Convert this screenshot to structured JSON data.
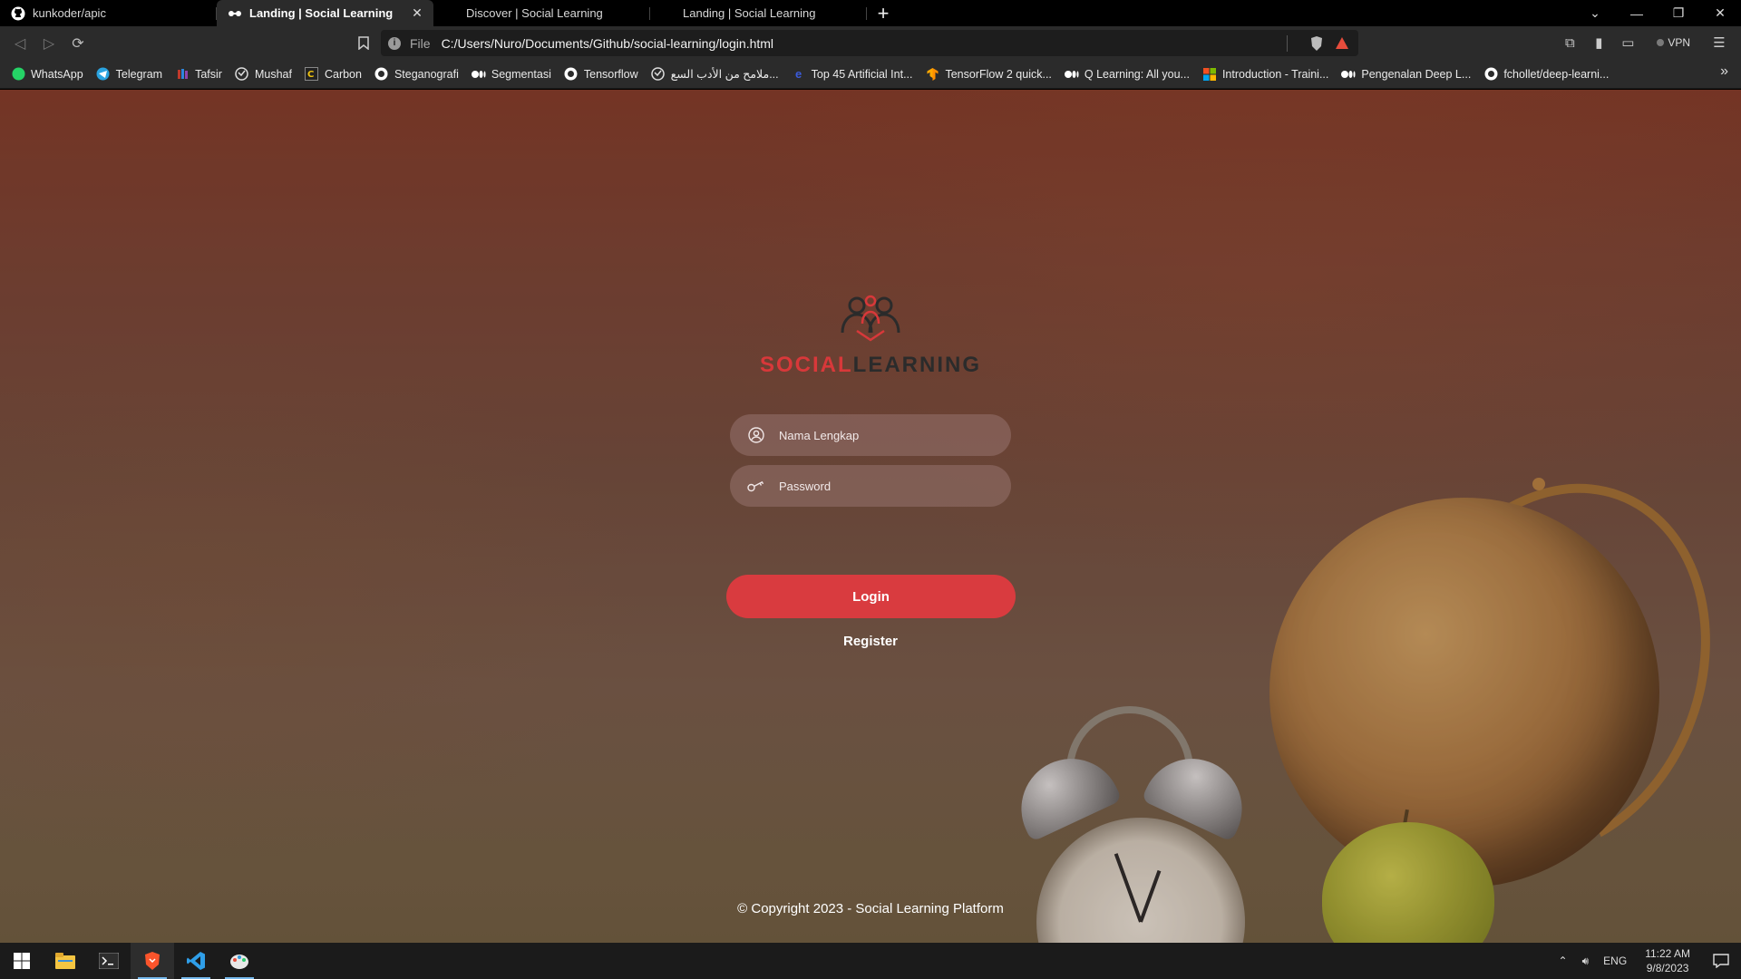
{
  "browser": {
    "tabs": [
      {
        "title": "kunkoder/apic",
        "icon": "github-icon",
        "active": false
      },
      {
        "title": "Landing | Social Learning",
        "icon": "social-learning-icon",
        "active": true
      },
      {
        "title": "Discover | Social Learning",
        "icon": "",
        "active": false
      },
      {
        "title": "Landing | Social Learning",
        "icon": "",
        "active": false
      }
    ],
    "new_tab_label": "+",
    "address": {
      "scheme_label": "File",
      "url": "C:/Users/Nuro/Documents/Github/social-learning/login.html"
    },
    "vpn_label": "VPN",
    "bookmarks": [
      {
        "label": "WhatsApp",
        "icon": "whatsapp-icon",
        "color": "#25d366"
      },
      {
        "label": "Telegram",
        "icon": "telegram-icon",
        "color": "#2aa3e0"
      },
      {
        "label": "Tafsir",
        "icon": "tafsir-icon",
        "color": "#c0392b"
      },
      {
        "label": "Mushaf",
        "icon": "globe-icon",
        "color": "#dddddd"
      },
      {
        "label": "Carbon",
        "icon": "carbon-icon",
        "color": "#222222"
      },
      {
        "label": "Steganografi",
        "icon": "github-icon",
        "color": "#ffffff"
      },
      {
        "label": "Segmentasi",
        "icon": "medium-icon",
        "color": "#ffffff"
      },
      {
        "label": "Tensorflow",
        "icon": "github-icon",
        "color": "#ffffff"
      },
      {
        "label": "ملامح من الأدب السع...",
        "icon": "globe-icon",
        "color": "#dddddd"
      },
      {
        "label": "Top 45 Artificial Int...",
        "icon": "e-icon",
        "color": "#3b5bdb"
      },
      {
        "label": "TensorFlow 2 quick...",
        "icon": "tensorflow-icon",
        "color": "#ff8f00"
      },
      {
        "label": "Q Learning: All you...",
        "icon": "medium-icon",
        "color": "#ffffff"
      },
      {
        "label": "Introduction - Traini...",
        "icon": "microsoft-icon",
        "color": "#f25022"
      },
      {
        "label": "Pengenalan Deep L...",
        "icon": "medium-icon",
        "color": "#ffffff"
      },
      {
        "label": "fchollet/deep-learni...",
        "icon": "github-icon",
        "color": "#ffffff"
      }
    ],
    "bookmarks_more": "»"
  },
  "page": {
    "brand": {
      "part1": "SOCIAL",
      "part2": "LEARNING",
      "accent": "#d8383a",
      "dark": "#2b2b2b"
    },
    "username_placeholder": "Nama Lengkap",
    "password_placeholder": "Password",
    "login_label": "Login",
    "register_label": "Register",
    "copyright": "© Copyright 2023 - Social Learning Platform",
    "button_color": "#d93b3f"
  },
  "taskbar": {
    "apps": [
      {
        "name": "windows-start-icon"
      },
      {
        "name": "file-explorer-icon"
      },
      {
        "name": "terminal-icon"
      },
      {
        "name": "brave-browser-icon",
        "active": true
      },
      {
        "name": "vscode-icon",
        "running": true
      },
      {
        "name": "paint-icon",
        "running": true
      }
    ],
    "language": "ENG",
    "time": "11:22 AM",
    "date": "9/8/2023"
  }
}
